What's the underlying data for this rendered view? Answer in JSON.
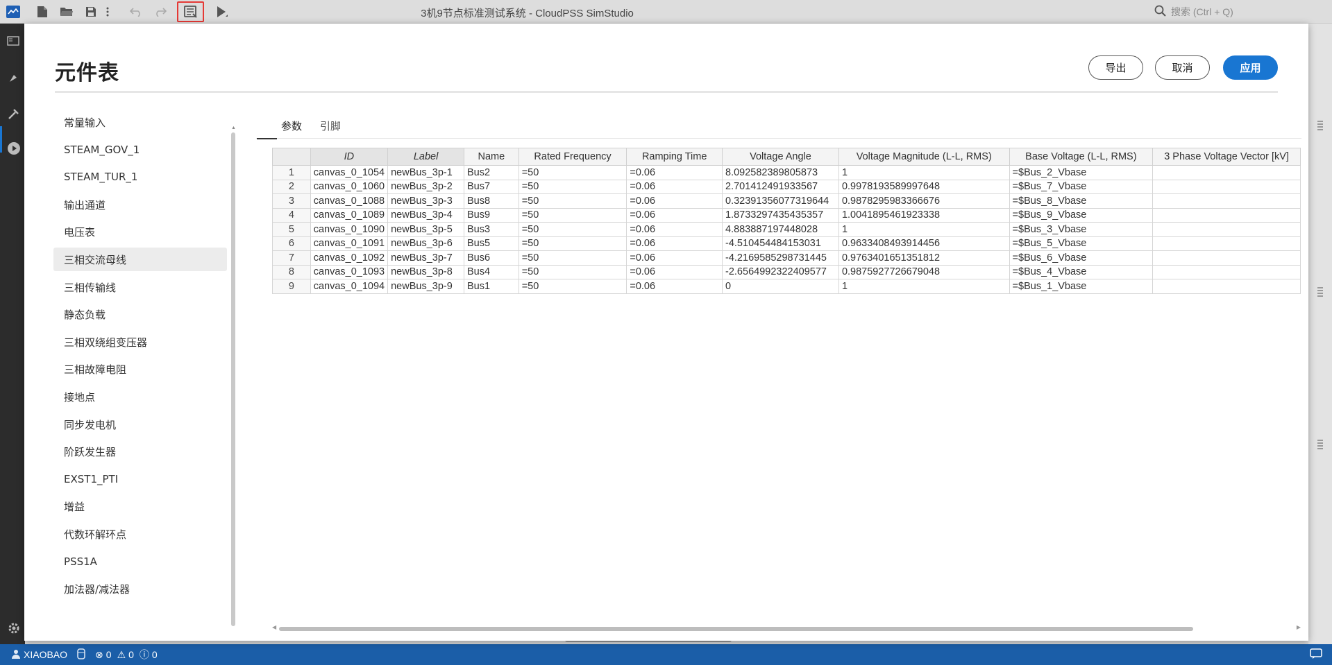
{
  "titlebar": {
    "title": "3机9节点标准测试系统 - CloudPSS SimStudio",
    "search_placeholder": "搜索 (Ctrl + Q)"
  },
  "modal": {
    "title": "元件表",
    "export_label": "导出",
    "cancel_label": "取消",
    "apply_label": "应用"
  },
  "sidebar": {
    "items": [
      {
        "label": "常量输入"
      },
      {
        "label": "STEAM_GOV_1"
      },
      {
        "label": "STEAM_TUR_1"
      },
      {
        "label": "输出通道"
      },
      {
        "label": "电压表"
      },
      {
        "label": "三相交流母线"
      },
      {
        "label": "三相传输线"
      },
      {
        "label": "静态负载"
      },
      {
        "label": "三相双绕组变压器"
      },
      {
        "label": "三相故障电阻"
      },
      {
        "label": "接地点"
      },
      {
        "label": "同步发电机"
      },
      {
        "label": "阶跃发生器"
      },
      {
        "label": "EXST1_PTI"
      },
      {
        "label": "增益"
      },
      {
        "label": "代数环解环点"
      },
      {
        "label": "PSS1A"
      },
      {
        "label": "加法器/减法器"
      }
    ],
    "active_index": 5
  },
  "tabs": [
    {
      "label": "参数"
    },
    {
      "label": "引脚"
    }
  ],
  "table": {
    "headers": [
      "",
      "ID",
      "Label",
      "Name",
      "Rated Frequency",
      "Ramping Time",
      "Voltage Angle",
      "Voltage Magnitude (L-L, RMS)",
      "Base Voltage (L-L, RMS)",
      "3 Phase Voltage Vector [kV]"
    ],
    "rows": [
      [
        "1",
        "canvas_0_1054",
        "newBus_3p-1",
        "Bus2",
        "=50",
        "=0.06",
        "8.092582389805873",
        "1",
        "=$Bus_2_Vbase",
        ""
      ],
      [
        "2",
        "canvas_0_1060",
        "newBus_3p-2",
        "Bus7",
        "=50",
        "=0.06",
        "2.701412491933567",
        "0.9978193589997648",
        "=$Bus_7_Vbase",
        ""
      ],
      [
        "3",
        "canvas_0_1088",
        "newBus_3p-3",
        "Bus8",
        "=50",
        "=0.06",
        "0.32391356077319644",
        "0.9878295983366676",
        "=$Bus_8_Vbase",
        ""
      ],
      [
        "4",
        "canvas_0_1089",
        "newBus_3p-4",
        "Bus9",
        "=50",
        "=0.06",
        "1.8733297435435357",
        "1.0041895461923338",
        "=$Bus_9_Vbase",
        ""
      ],
      [
        "5",
        "canvas_0_1090",
        "newBus_3p-5",
        "Bus3",
        "=50",
        "=0.06",
        "4.883887197448028",
        "1",
        "=$Bus_3_Vbase",
        ""
      ],
      [
        "6",
        "canvas_0_1091",
        "newBus_3p-6",
        "Bus5",
        "=50",
        "=0.06",
        "-4.510454484153031",
        "0.9633408493914456",
        "=$Bus_5_Vbase",
        ""
      ],
      [
        "7",
        "canvas_0_1092",
        "newBus_3p-7",
        "Bus6",
        "=50",
        "=0.06",
        "-4.2169585298731445",
        "0.9763401651351812",
        "=$Bus_6_Vbase",
        ""
      ],
      [
        "8",
        "canvas_0_1093",
        "newBus_3p-8",
        "Bus4",
        "=50",
        "=0.06",
        "-2.6564992322409577",
        "0.9875927726679048",
        "=$Bus_4_Vbase",
        ""
      ],
      [
        "9",
        "canvas_0_1094",
        "newBus_3p-9",
        "Bus1",
        "=50",
        "=0.06",
        "0",
        "1",
        "=$Bus_1_Vbase",
        ""
      ]
    ]
  },
  "statusbar": {
    "user": "XIAOBAO",
    "errors": "0",
    "warnings": "0",
    "infos": "0"
  },
  "colors": {
    "accent": "#1976d2",
    "statusbar": "#1b5ea8",
    "highlight": "#e53935"
  }
}
